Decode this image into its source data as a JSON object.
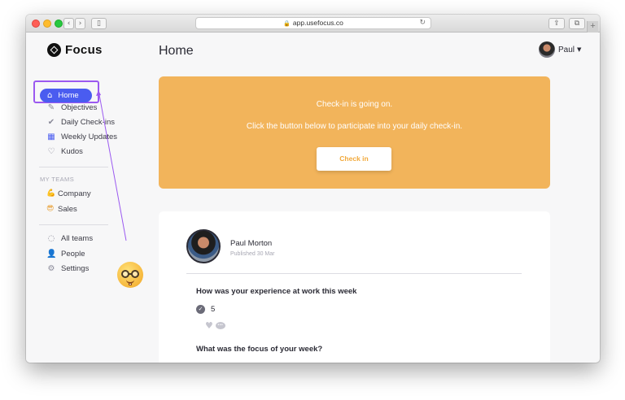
{
  "browser": {
    "url": "app.usefocus.co",
    "back_icon": "chevron-left-icon",
    "forward_icon": "chevron-right-icon",
    "reload_icon": "reload-icon"
  },
  "app": {
    "name": "Focus"
  },
  "sidebar": {
    "home_label": "Home",
    "items": [
      {
        "label": "Objectives",
        "icon": "pencil-icon"
      },
      {
        "label": "Daily Check-ins",
        "icon": "check-circle-icon"
      },
      {
        "label": "Weekly Updates",
        "icon": "calendar-icon"
      },
      {
        "label": "Kudos",
        "icon": "shield-heart-icon"
      }
    ],
    "teams_heading": "MY TEAMS",
    "teams": [
      {
        "label": "Company",
        "icon": "flexed-biceps-icon"
      },
      {
        "label": "Sales",
        "icon": "sunglasses-face-icon"
      }
    ],
    "footer_items": [
      {
        "label": "All teams",
        "icon": "teams-circle-icon"
      },
      {
        "label": "People",
        "icon": "person-icon"
      },
      {
        "label": "Settings",
        "icon": "gear-icon"
      }
    ]
  },
  "main": {
    "page_title": "Home",
    "user_name": "Paul"
  },
  "banner": {
    "line1": "Check-in is going on.",
    "line2": "Click the button below to participate into your daily check-in.",
    "button_label": "Check in"
  },
  "checkin_card": {
    "author": "Paul Morton",
    "published": "Published 30 Mar",
    "question_1": "How was your experience at work this week",
    "answer_1": "5",
    "question_2": "What was the focus of your week?"
  },
  "colors": {
    "accent": "#4a5cf0",
    "banner": "#f2b45b",
    "highlight": "#9b59f0"
  }
}
